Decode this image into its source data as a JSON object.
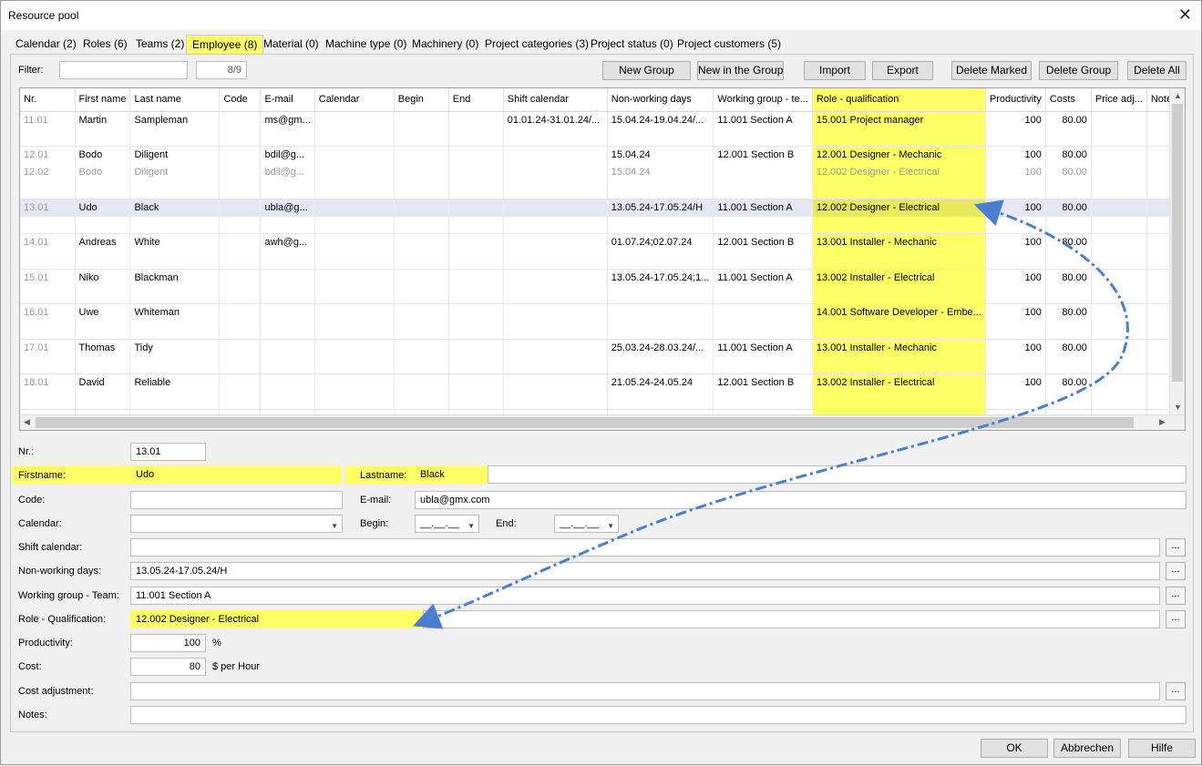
{
  "window": {
    "title": "Resource pool",
    "close_glyph": "✕"
  },
  "tabs": [
    {
      "label": "Calendar (2)"
    },
    {
      "label": "Roles (6)"
    },
    {
      "label": "Teams (2)"
    },
    {
      "label": "Employee (8)"
    },
    {
      "label": "Material (0)"
    },
    {
      "label": "Machine type (0)"
    },
    {
      "label": "Machinery (0)"
    },
    {
      "label": "Project categories (3)"
    },
    {
      "label": "Project status (0)"
    },
    {
      "label": "Project customers (5)"
    }
  ],
  "toolbar": {
    "filter_label": "Filter:",
    "filter_value": "",
    "count": "8/9",
    "new_group": "New Group",
    "new_in_group": "New in the Group",
    "import": "Import",
    "export": "Export",
    "delete_marked": "Delete Marked",
    "delete_group": "Delete Group",
    "delete_all": "Delete All"
  },
  "grid": {
    "columns": [
      "Nr.",
      "First name",
      "Last name",
      "Code",
      "E-mail",
      "Calendar",
      "Begin",
      "End",
      "Shift calendar",
      "Non-working days",
      "Working group - te...",
      "Role - qualification",
      "Productivity",
      "Costs",
      "Price adj...",
      "Notes"
    ],
    "rows": [
      {
        "nr": "11.01",
        "first": "Martin",
        "last": "Sampleman",
        "code": "",
        "email": "ms@gm...",
        "calendar": "",
        "begin": "",
        "end": "",
        "shift": "01.01.24-31.01.24/...",
        "nonwork": "15.04.24-19.04.24/...",
        "group": "11.001 Section A",
        "role": "15.001 Project manager",
        "prod": "100",
        "costs": "80.00",
        "price": "",
        "notes": ""
      },
      {
        "nr": "",
        "first": "",
        "last": "",
        "code": "",
        "email": "",
        "calendar": "",
        "begin": "",
        "end": "",
        "shift": "",
        "nonwork": "",
        "group": "",
        "role": "",
        "prod": "",
        "costs": "",
        "price": "",
        "notes": ""
      },
      {
        "nr": "12.01",
        "first": "Bodo",
        "last": "Diligent",
        "code": "",
        "email": "bdil@g...",
        "calendar": "",
        "begin": "",
        "end": "",
        "shift": "",
        "nonwork": "15.04.24",
        "group": "12.001 Section B",
        "role": "12.001 Designer - Mechanic",
        "prod": "100",
        "costs": "80.00",
        "price": "",
        "notes": ""
      },
      {
        "nr": "12.02",
        "first": "Bodo",
        "last": "Diligent",
        "code": "",
        "email": "bdil@g...",
        "calendar": "",
        "begin": "",
        "end": "",
        "shift": "",
        "nonwork": "15.04.24",
        "group": "",
        "role": "12.002 Designer - Electrical",
        "prod": "100",
        "costs": "80.00",
        "price": "",
        "notes": ""
      },
      {
        "nr": "",
        "first": "",
        "last": "",
        "code": "",
        "email": "",
        "calendar": "",
        "begin": "",
        "end": "",
        "shift": "",
        "nonwork": "",
        "group": "",
        "role": "",
        "prod": "",
        "costs": "",
        "price": "",
        "notes": ""
      },
      {
        "nr": "13.01",
        "first": "Udo",
        "last": "Black",
        "code": "",
        "email": "ubla@g...",
        "calendar": "",
        "begin": "",
        "end": "",
        "shift": "",
        "nonwork": "13.05.24-17.05.24/H",
        "group": "11.001 Section A",
        "role": "12.002 Designer - Electrical",
        "prod": "100",
        "costs": "80.00",
        "price": "",
        "notes": ""
      },
      {
        "nr": "",
        "first": "",
        "last": "",
        "code": "",
        "email": "",
        "calendar": "",
        "begin": "",
        "end": "",
        "shift": "",
        "nonwork": "",
        "group": "",
        "role": "",
        "prod": "",
        "costs": "",
        "price": "",
        "notes": ""
      },
      {
        "nr": "14.01",
        "first": "Andreas",
        "last": "White",
        "code": "",
        "email": "awh@g...",
        "calendar": "",
        "begin": "",
        "end": "",
        "shift": "",
        "nonwork": "01.07.24;02.07.24",
        "group": "12.001 Section B",
        "role": "13.001 Installer - Mechanic",
        "prod": "100",
        "costs": "80.00",
        "price": "",
        "notes": ""
      },
      {
        "nr": "",
        "first": "",
        "last": "",
        "code": "",
        "email": "",
        "calendar": "",
        "begin": "",
        "end": "",
        "shift": "",
        "nonwork": "",
        "group": "",
        "role": "",
        "prod": "",
        "costs": "",
        "price": "",
        "notes": ""
      },
      {
        "nr": "15.01",
        "first": "Niko",
        "last": "Blackman",
        "code": "",
        "email": "",
        "calendar": "",
        "begin": "",
        "end": "",
        "shift": "",
        "nonwork": "13.05.24-17.05.24;1...",
        "group": "11.001 Section A",
        "role": "13.002 Installer - Electrical",
        "prod": "100",
        "costs": "80.00",
        "price": "",
        "notes": ""
      },
      {
        "nr": "",
        "first": "",
        "last": "",
        "code": "",
        "email": "",
        "calendar": "",
        "begin": "",
        "end": "",
        "shift": "",
        "nonwork": "",
        "group": "",
        "role": "",
        "prod": "",
        "costs": "",
        "price": "",
        "notes": ""
      },
      {
        "nr": "16.01",
        "first": "Uwe",
        "last": "Whiteman",
        "code": "",
        "email": "",
        "calendar": "",
        "begin": "",
        "end": "",
        "shift": "",
        "nonwork": "",
        "group": "",
        "role": "14.001 Software Developer - Embe...",
        "prod": "100",
        "costs": "80.00",
        "price": "",
        "notes": ""
      },
      {
        "nr": "",
        "first": "",
        "last": "",
        "code": "",
        "email": "",
        "calendar": "",
        "begin": "",
        "end": "",
        "shift": "",
        "nonwork": "",
        "group": "",
        "role": "",
        "prod": "",
        "costs": "",
        "price": "",
        "notes": ""
      },
      {
        "nr": "17.01",
        "first": "Thomas",
        "last": "Tidy",
        "code": "",
        "email": "",
        "calendar": "",
        "begin": "",
        "end": "",
        "shift": "",
        "nonwork": "25.03.24-28.03.24/...",
        "group": "11.001 Section A",
        "role": "13.001 Installer - Mechanic",
        "prod": "100",
        "costs": "80.00",
        "price": "",
        "notes": ""
      },
      {
        "nr": "",
        "first": "",
        "last": "",
        "code": "",
        "email": "",
        "calendar": "",
        "begin": "",
        "end": "",
        "shift": "",
        "nonwork": "",
        "group": "",
        "role": "",
        "prod": "",
        "costs": "",
        "price": "",
        "notes": ""
      },
      {
        "nr": "18.01",
        "first": "David",
        "last": "Reliable",
        "code": "",
        "email": "",
        "calendar": "",
        "begin": "",
        "end": "",
        "shift": "",
        "nonwork": "21.05.24-24.05.24",
        "group": "12.001 Section B",
        "role": "13.002 Installer - Electrical",
        "prod": "100",
        "costs": "80.00",
        "price": "",
        "notes": ""
      },
      {
        "nr": "",
        "first": "",
        "last": "",
        "code": "",
        "email": "",
        "calendar": "",
        "begin": "",
        "end": "",
        "shift": "",
        "nonwork": "",
        "group": "",
        "role": "",
        "prod": "",
        "costs": "",
        "price": "",
        "notes": ""
      },
      {
        "nr": "*",
        "first": "",
        "last": "",
        "code": "",
        "email": "",
        "calendar": "",
        "begin": "",
        "end": "",
        "shift": "",
        "nonwork": "",
        "group": "",
        "role": "",
        "prod": "",
        "costs": "",
        "price": "",
        "notes": ""
      }
    ]
  },
  "form": {
    "nr_label": "Nr.:",
    "nr_value": "13.01",
    "firstname_label": "Firstname:",
    "firstname_value": "Udo",
    "lastname_label": "Lastname:",
    "lastname_value": "Black",
    "code_label": "Code:",
    "code_value": "",
    "email_label": "E-mail:",
    "email_value": "ubla@gmx.com",
    "calendar_label": "Calendar:",
    "calendar_value": "",
    "begin_label": "Begin:",
    "begin_value": "__.__.__",
    "end_label": "End:",
    "end_value": "__.__.__",
    "shift_label": "Shift calendar:",
    "shift_value": "",
    "nonwork_label": "Non-working days:",
    "nonwork_value": "13.05.24-17.05.24/H",
    "group_label": "Working group - Team:",
    "group_value": "11.001 Section A",
    "role_label": "Role - Qualification:",
    "role_value": "12.002 Designer - Electrical",
    "productivity_label": "Productivity:",
    "productivity_value": "100",
    "productivity_unit": "%",
    "cost_label": "Cost:",
    "cost_value": "80",
    "cost_unit": "$ per Hour",
    "costadj_label": "Cost adjustment:",
    "costadj_value": "",
    "notes_label": "Notes:",
    "notes_value": "",
    "ellipsis": "..."
  },
  "footer": {
    "ok": "OK",
    "cancel": "Abbrechen",
    "help": "Hilfe"
  },
  "colors": {
    "highlight": "#ffff66",
    "arrow": "#4a7fd0",
    "selected_row": "#e6e6f5"
  }
}
